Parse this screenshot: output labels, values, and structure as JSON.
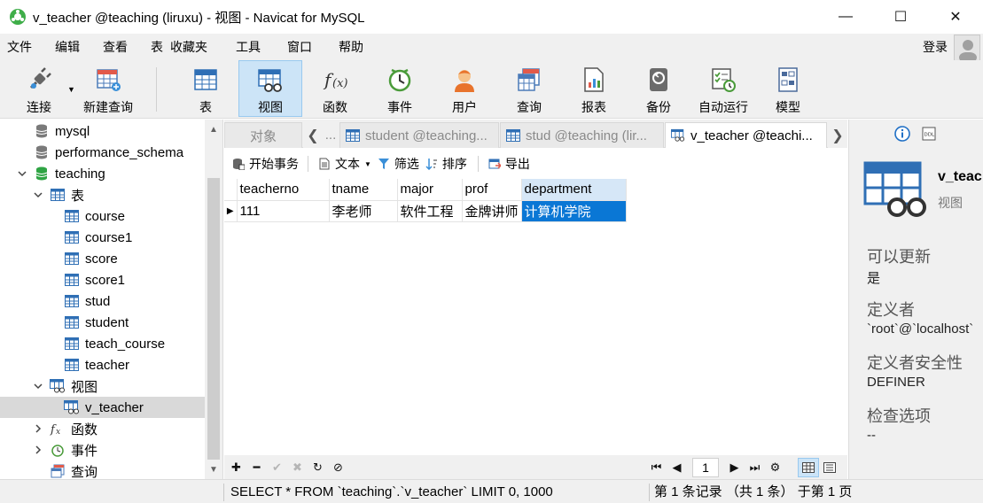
{
  "window": {
    "title": "v_teacher @teaching (liruxu) - 视图 - Navicat for MySQL",
    "minimize": "—",
    "maximize": "☐",
    "close": "✕"
  },
  "menu": {
    "items": [
      "文件",
      "编辑",
      "查看",
      "表",
      "收藏夹",
      "工具",
      "窗口",
      "帮助"
    ],
    "login": "登录"
  },
  "toolbar": {
    "buttons": [
      {
        "label": "连接",
        "icon": "plug-icon"
      },
      {
        "label": "新建查询",
        "icon": "new-query-icon"
      },
      {
        "label": "表",
        "icon": "table-icon"
      },
      {
        "label": "视图",
        "icon": "view-icon",
        "active": true
      },
      {
        "label": "函数",
        "icon": "function-icon"
      },
      {
        "label": "事件",
        "icon": "clock-icon"
      },
      {
        "label": "用户",
        "icon": "user-icon"
      },
      {
        "label": "查询",
        "icon": "query-icon"
      },
      {
        "label": "报表",
        "icon": "report-icon"
      },
      {
        "label": "备份",
        "icon": "backup-icon"
      },
      {
        "label": "自动运行",
        "icon": "schedule-icon"
      },
      {
        "label": "模型",
        "icon": "model-icon"
      }
    ]
  },
  "nav": {
    "items": [
      {
        "label": "mysql",
        "type": "db-gray"
      },
      {
        "label": "performance_schema",
        "type": "db-gray"
      },
      {
        "label": "teaching",
        "type": "db-green"
      },
      {
        "label": "表",
        "type": "table-folder"
      },
      {
        "label": "course",
        "type": "table"
      },
      {
        "label": "course1",
        "type": "table"
      },
      {
        "label": "score",
        "type": "table"
      },
      {
        "label": "score1",
        "type": "table"
      },
      {
        "label": "stud",
        "type": "table"
      },
      {
        "label": "student",
        "type": "table"
      },
      {
        "label": "teach_course",
        "type": "table"
      },
      {
        "label": "teacher",
        "type": "table"
      },
      {
        "label": "视图",
        "type": "view-folder"
      },
      {
        "label": "v_teacher",
        "type": "view"
      },
      {
        "label": "函数",
        "type": "function-folder"
      },
      {
        "label": "事件",
        "type": "event-folder"
      },
      {
        "label": "查询",
        "type": "query-folder"
      }
    ]
  },
  "tabs": {
    "objects": "对象",
    "ellipsis": "...",
    "items": [
      {
        "label": "student @teaching..."
      },
      {
        "label": "stud @teaching (lir..."
      },
      {
        "label": "v_teacher @teachi..."
      }
    ]
  },
  "object_toolbar": {
    "begin_transaction": "开始事务",
    "text": "文本",
    "filter": "筛选",
    "sort": "排序",
    "export": "导出"
  },
  "grid": {
    "columns": [
      "teacherno",
      "tname",
      "major",
      "prof",
      "department"
    ],
    "rows": [
      [
        "111",
        "李老师",
        "软件工程",
        "金牌讲师",
        "计算机学院"
      ]
    ]
  },
  "bottom_nav": {
    "page": "1"
  },
  "info": {
    "name": "v_teacher",
    "type": "视图",
    "props": [
      {
        "label": "可以更新",
        "value": "是"
      },
      {
        "label": "定义者",
        "value": "`root`@`localhost`"
      },
      {
        "label": "定义者安全性",
        "value": "DEFINER"
      },
      {
        "label": "检查选项",
        "value": "--"
      }
    ]
  },
  "status": {
    "sql": "SELECT * FROM `teaching`.`v_teacher` LIMIT 0, 1000",
    "records": "第 1 条记录 （共 1 条） 于第 1 页"
  }
}
